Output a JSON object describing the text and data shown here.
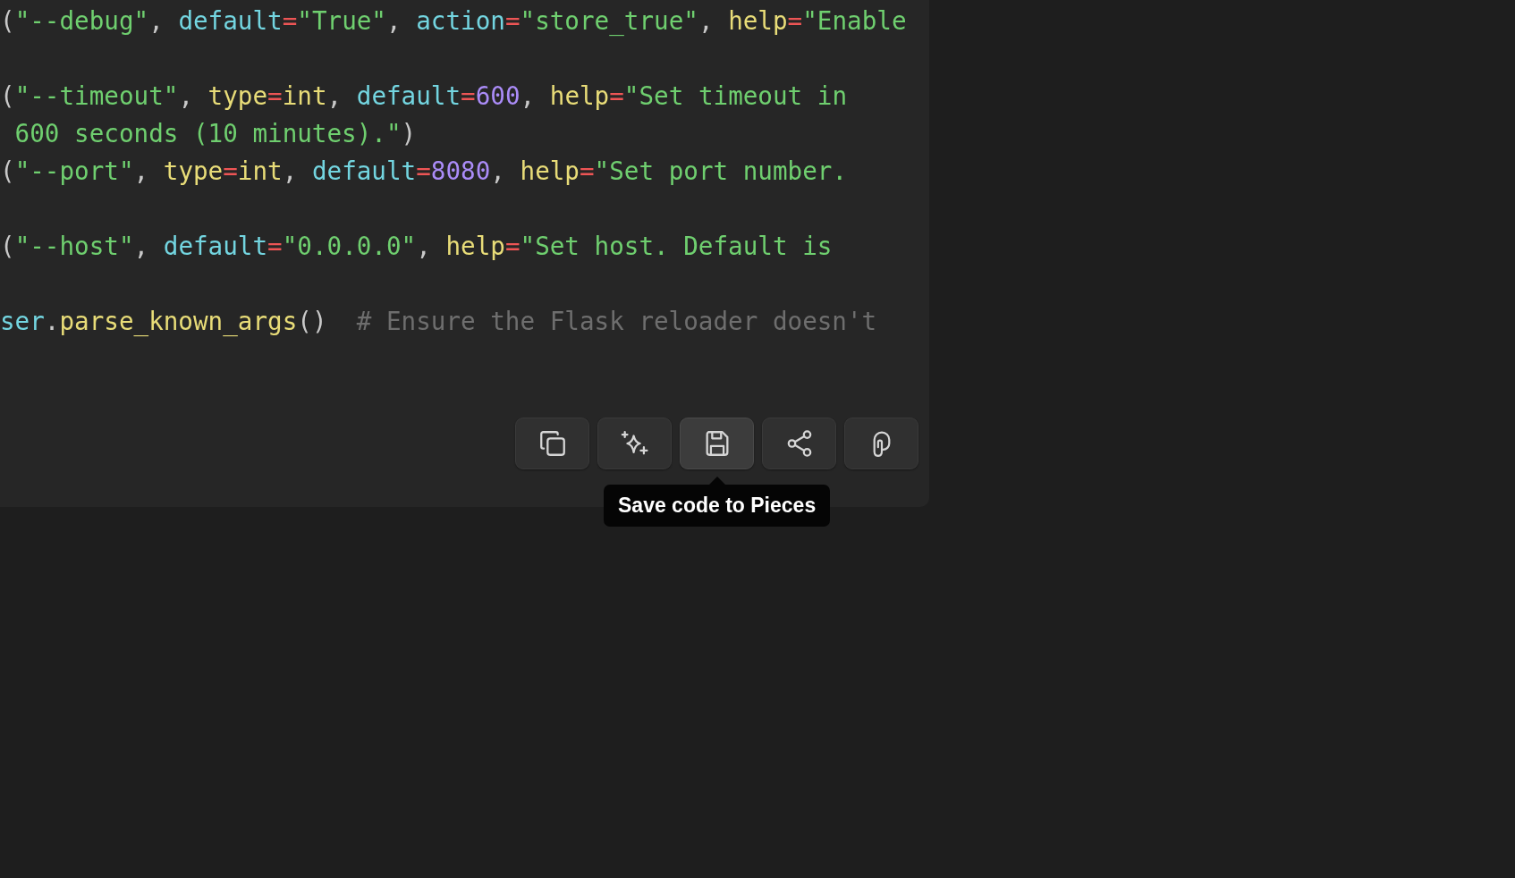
{
  "code_lines": [
    {
      "kind": "code",
      "tokens": [
        {
          "t": "(",
          "kind": "punct"
        },
        {
          "t": "\"--debug\"",
          "kind": "string"
        },
        {
          "t": ", ",
          "kind": "punct"
        },
        {
          "t": "default",
          "kind": "param"
        },
        {
          "t": "=",
          "kind": "op"
        },
        {
          "t": "\"True\"",
          "kind": "string"
        },
        {
          "t": ", ",
          "kind": "punct"
        },
        {
          "t": "action",
          "kind": "param"
        },
        {
          "t": "=",
          "kind": "op"
        },
        {
          "t": "\"store_true\"",
          "kind": "string"
        },
        {
          "t": ", ",
          "kind": "punct"
        },
        {
          "t": "help",
          "kind": "func"
        },
        {
          "t": "=",
          "kind": "op"
        },
        {
          "t": "\"Enable",
          "kind": "string"
        }
      ]
    },
    {
      "kind": "blank"
    },
    {
      "kind": "code",
      "tokens": [
        {
          "t": "(",
          "kind": "punct"
        },
        {
          "t": "\"--timeout\"",
          "kind": "string"
        },
        {
          "t": ", ",
          "kind": "punct"
        },
        {
          "t": "type",
          "kind": "func"
        },
        {
          "t": "=",
          "kind": "op"
        },
        {
          "t": "int",
          "kind": "func"
        },
        {
          "t": ", ",
          "kind": "punct"
        },
        {
          "t": "default",
          "kind": "param"
        },
        {
          "t": "=",
          "kind": "op"
        },
        {
          "t": "600",
          "kind": "number"
        },
        {
          "t": ", ",
          "kind": "punct"
        },
        {
          "t": "help",
          "kind": "func"
        },
        {
          "t": "=",
          "kind": "op"
        },
        {
          "t": "\"Set timeout in",
          "kind": "string"
        }
      ]
    },
    {
      "kind": "code",
      "tokens": [
        {
          "t": " 600 seconds (10 minutes).\"",
          "kind": "string"
        },
        {
          "t": ")",
          "kind": "punct"
        }
      ]
    },
    {
      "kind": "code",
      "tokens": [
        {
          "t": "(",
          "kind": "punct"
        },
        {
          "t": "\"--port\"",
          "kind": "string"
        },
        {
          "t": ", ",
          "kind": "punct"
        },
        {
          "t": "type",
          "kind": "func"
        },
        {
          "t": "=",
          "kind": "op"
        },
        {
          "t": "int",
          "kind": "func"
        },
        {
          "t": ", ",
          "kind": "punct"
        },
        {
          "t": "default",
          "kind": "param"
        },
        {
          "t": "=",
          "kind": "op"
        },
        {
          "t": "8080",
          "kind": "number"
        },
        {
          "t": ", ",
          "kind": "punct"
        },
        {
          "t": "help",
          "kind": "func"
        },
        {
          "t": "=",
          "kind": "op"
        },
        {
          "t": "\"Set port number.",
          "kind": "string"
        }
      ]
    },
    {
      "kind": "blank"
    },
    {
      "kind": "code",
      "tokens": [
        {
          "t": "(",
          "kind": "punct"
        },
        {
          "t": "\"--host\"",
          "kind": "string"
        },
        {
          "t": ", ",
          "kind": "punct"
        },
        {
          "t": "default",
          "kind": "param"
        },
        {
          "t": "=",
          "kind": "op"
        },
        {
          "t": "\"0.0.0.0\"",
          "kind": "string"
        },
        {
          "t": ", ",
          "kind": "punct"
        },
        {
          "t": "help",
          "kind": "func"
        },
        {
          "t": "=",
          "kind": "op"
        },
        {
          "t": "\"Set host. Default is",
          "kind": "string"
        }
      ]
    },
    {
      "kind": "blank"
    },
    {
      "kind": "code",
      "tokens": [
        {
          "t": "ser",
          "kind": "param"
        },
        {
          "t": ".",
          "kind": "punct"
        },
        {
          "t": "parse_known_args",
          "kind": "func"
        },
        {
          "t": "()",
          "kind": "punct"
        },
        {
          "t": "  # Ensure the Flask reloader doesn't",
          "kind": "comment"
        }
      ]
    }
  ],
  "toolbar": [
    {
      "kind": "copy",
      "hovered": false
    },
    {
      "kind": "sparkle",
      "hovered": false
    },
    {
      "kind": "save",
      "hovered": true
    },
    {
      "kind": "share",
      "hovered": false
    },
    {
      "kind": "pieces",
      "hovered": false
    }
  ],
  "tooltip": {
    "text": "Save code to Pieces"
  }
}
